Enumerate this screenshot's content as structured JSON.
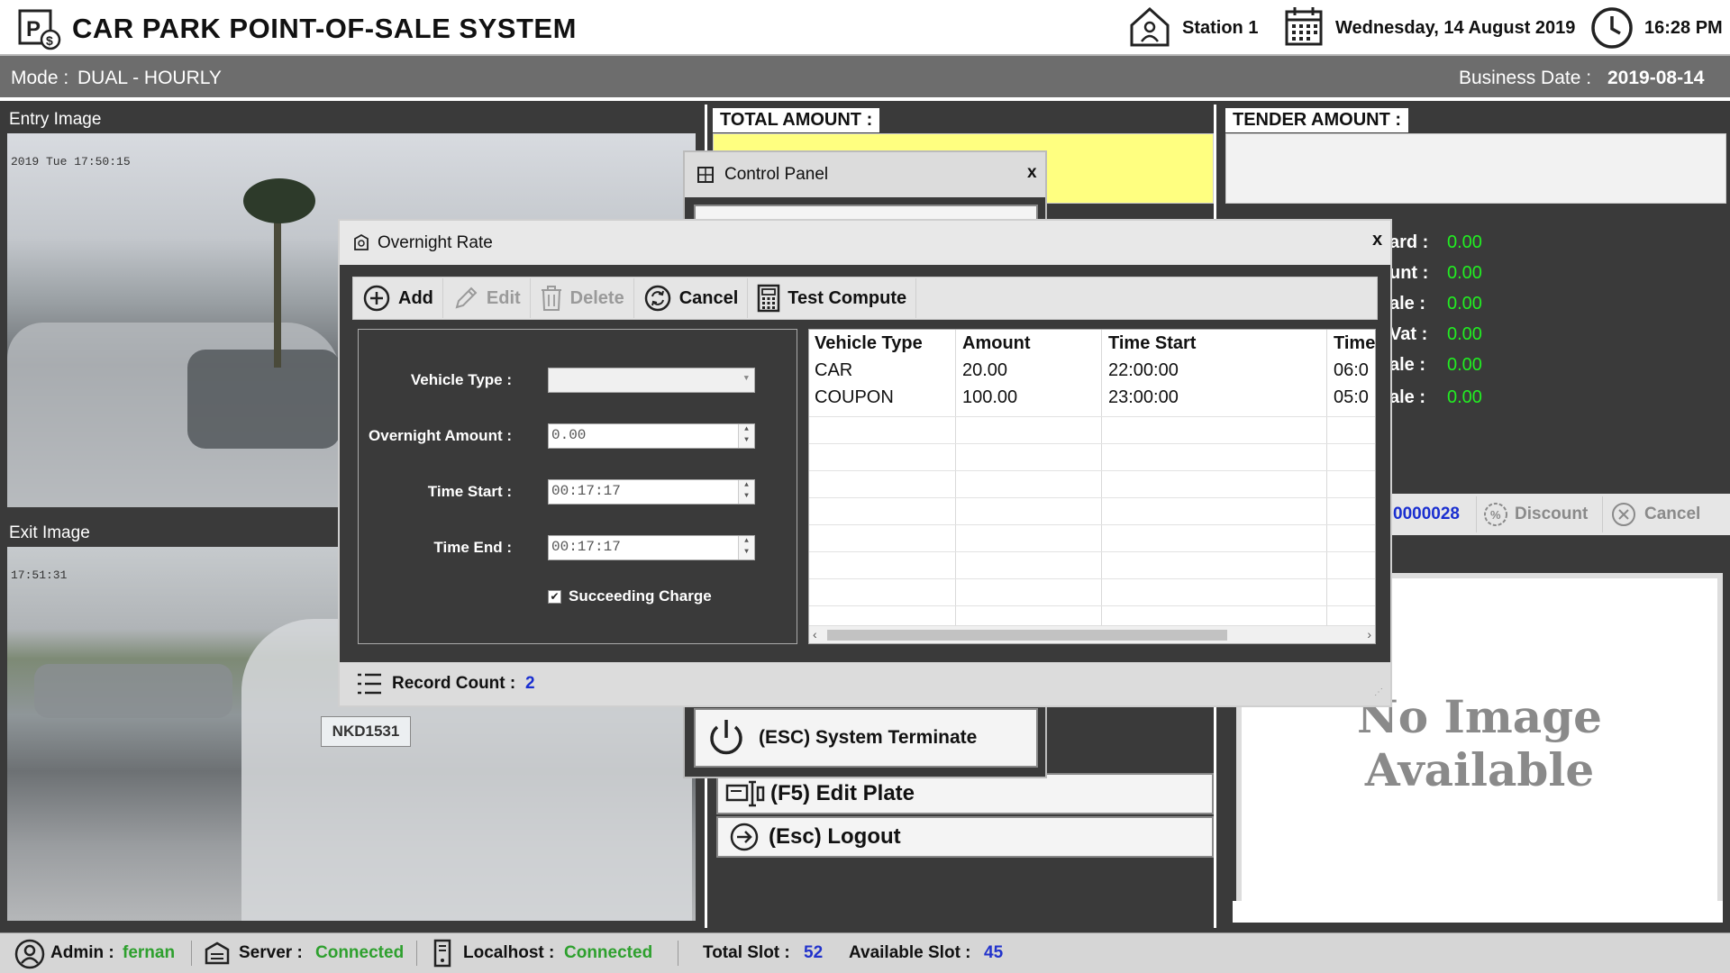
{
  "header": {
    "title": "CAR PARK POINT-OF-SALE SYSTEM",
    "station": "Station 1",
    "date": "Wednesday, 14 August 2019",
    "time": "16:28 PM"
  },
  "modebar": {
    "mode_label": "Mode :",
    "mode_value": "DUAL - HOURLY",
    "business_label": "Business Date :",
    "business_value": "2019-08-14"
  },
  "images": {
    "entry_title": "Entry Image",
    "entry_overlay": "2019 Tue 17:50:15",
    "exit_title": "Exit Image",
    "exit_overlay": "17:51:31",
    "exit_plate": "NKD1531",
    "no_image_line1": "No Image",
    "no_image_line2": "Available"
  },
  "center": {
    "total_amount_label": "TOTAL AMOUNT :",
    "tender_amount_label": "TENDER AMOUNT :"
  },
  "right": {
    "rows": [
      {
        "label": "ard :",
        "value": "0.00"
      },
      {
        "label": "unt :",
        "value": "0.00"
      },
      {
        "label": "ale :",
        "value": "0.00"
      },
      {
        "label": "Vat :",
        "value": "0.00"
      },
      {
        "label": "ale :",
        "value": "0.00"
      },
      {
        "label": "ale :",
        "value": "0.00"
      }
    ],
    "ticket_no": "0000028",
    "discount_label": "Discount",
    "cancel_label": "Cancel"
  },
  "menu": {
    "terminate": "(ESC) System Terminate",
    "edit_plate": "(F5) Edit Plate",
    "logout": "(Esc) Logout"
  },
  "control_panel": {
    "title": "Control Panel",
    "close": "x"
  },
  "dialog": {
    "title": "Overnight Rate",
    "close": "x",
    "toolbar": {
      "add": "Add",
      "edit": "Edit",
      "delete": "Delete",
      "cancel": "Cancel",
      "test_compute": "Test Compute"
    },
    "form": {
      "vehicle_type_label": "Vehicle Type :",
      "vehicle_type_value": "",
      "amount_label": "Overnight Amount :",
      "amount_value": "0.00",
      "time_start_label": "Time Start :",
      "time_start_value": "00:17:17",
      "time_end_label": "Time End :",
      "time_end_value": "00:17:17",
      "succeeding_label": "Succeeding Charge",
      "succeeding_checked": true
    },
    "grid": {
      "columns": [
        "Vehicle Type",
        "Amount",
        "Time Start",
        "Time"
      ],
      "rows": [
        [
          "CAR",
          "20.00",
          "22:00:00",
          "06:0"
        ],
        [
          "COUPON",
          "100.00",
          "23:00:00",
          "05:0"
        ]
      ]
    },
    "footer": {
      "record_label": "Record Count :",
      "record_value": "2"
    }
  },
  "statusbar": {
    "admin_label": "Admin :",
    "admin_value": "fernan",
    "server_label": "Server :",
    "server_value": "Connected",
    "localhost_label": "Localhost :",
    "localhost_value": "Connected",
    "total_slot_label": "Total Slot :",
    "total_slot_value": "52",
    "available_slot_label": "Available Slot :",
    "available_slot_value": "45"
  }
}
